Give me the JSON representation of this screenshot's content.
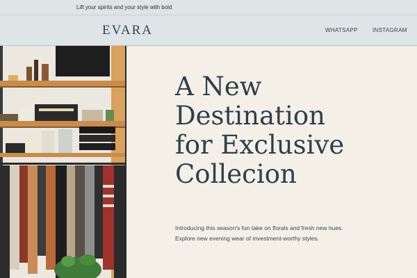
{
  "announcement": {
    "text": "Lift your spirits and your style with bold"
  },
  "header": {
    "logo": "EVARA",
    "nav": [
      {
        "label": "WHATSAPP"
      },
      {
        "label": "INSTAGRAM"
      }
    ]
  },
  "hero": {
    "image_description_icon": "clothing-store-photo",
    "headline_lines": [
      "A New",
      "Destination",
      "for Exclusive",
      "Collecion"
    ],
    "subtext_lines": [
      "Introducing this season's fun take on florals and fresh new hues.",
      "Explore new evening wear of investment-worthy styles."
    ]
  },
  "colors": {
    "header_bg": "#dfe5e6",
    "page_bg": "#f4f0e8",
    "text_dark": "#2e3f4a"
  }
}
